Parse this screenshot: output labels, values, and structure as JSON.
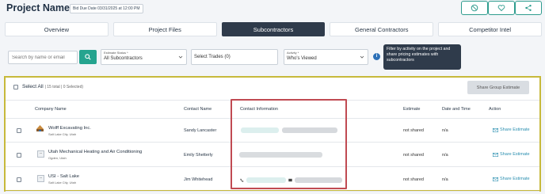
{
  "header": {
    "project_title": "Project Name: Test",
    "due_badge": "Bid Due Date 03/31/2025 at 12:00 PM",
    "buttons": [
      {
        "name": "hide-icon"
      },
      {
        "name": "heart-icon"
      },
      {
        "name": "share-icon"
      }
    ]
  },
  "tabs": [
    {
      "label": "Overview",
      "active": false
    },
    {
      "label": "Project Files",
      "active": false
    },
    {
      "label": "Subcontractors",
      "active": true
    },
    {
      "label": "General Contractors",
      "active": false
    },
    {
      "label": "Competitor Intel",
      "active": false
    }
  ],
  "filters": {
    "search_placeholder": "Search by name or email",
    "estimate_status_caption": "Estimate Status *",
    "estimate_status_value": "All Subcontractors",
    "trades_value": "Select Trades (0)",
    "activity_caption": "Activity *",
    "activity_value": "Who's Viewed",
    "info_symbol": "i",
    "tooltip": "Filter by activity on the project and share pricing estimates with subcontractors"
  },
  "panel": {
    "select_all_label": "Select All",
    "select_all_sub": "| 15 total | 0 Selected)",
    "share_group_label": "Share Group Estimate",
    "columns": [
      "Company Name",
      "Contact Name",
      "Contact Information",
      "Estimate",
      "Date and Time",
      "Action"
    ],
    "rows": [
      {
        "company": "Wolff Excavating Inc.",
        "location": "Salt Lake City, Utah",
        "contact": "Sandy Lancaster",
        "estimate": "not shared",
        "datetime": "n/a",
        "action": "Share Estimate",
        "logo": "wolff-logo-icon"
      },
      {
        "company": "Utah Mechanical Heating and Air Conditioning",
        "location": "Ogden, Utah",
        "contact": "Emily Shetterly",
        "estimate": "not shared",
        "datetime": "n/a",
        "action": "Share Estimate",
        "logo_text": "--"
      },
      {
        "company": "USI - Salt Lake",
        "location": "Salt Lake City, Utah",
        "contact": "Jim Whitehead",
        "estimate": "not shared",
        "datetime": "n/a",
        "action": "Share Estimate",
        "logo_text": "--"
      }
    ]
  },
  "colors": {
    "accent": "#25a48f",
    "active_tab": "#2f3b4b",
    "highlight_outer": "#c7b93b",
    "highlight_inner": "#c04a52",
    "link": "#2b8fb0"
  }
}
